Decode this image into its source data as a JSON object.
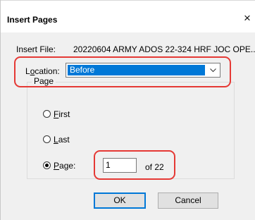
{
  "dialog": {
    "title": "Insert Pages",
    "close_glyph": "×"
  },
  "insert_file": {
    "label": "Insert File:",
    "value": "20220604 ARMY ADOS 22-324 HRF JOC OPE..."
  },
  "location": {
    "label_prefix": "L",
    "label_underlined": "o",
    "label_suffix": "cation:",
    "selected": "Before"
  },
  "page_group": {
    "title": "Page",
    "options": [
      {
        "underlined": "F",
        "rest": "irst",
        "selected": false
      },
      {
        "underlined": "L",
        "rest": "ast",
        "selected": false
      },
      {
        "underlined": "P",
        "rest": "age:",
        "selected": true
      }
    ],
    "page_value": "1",
    "of_text": "of 22"
  },
  "buttons": {
    "ok": "OK",
    "cancel": "Cancel"
  },
  "colors": {
    "selection_blue": "#0078d7",
    "highlight_red": "#e53935",
    "dialog_bg": "#f0f0f0"
  },
  "icons": {
    "close": "close-icon",
    "dropdown": "chevron-down-icon"
  }
}
